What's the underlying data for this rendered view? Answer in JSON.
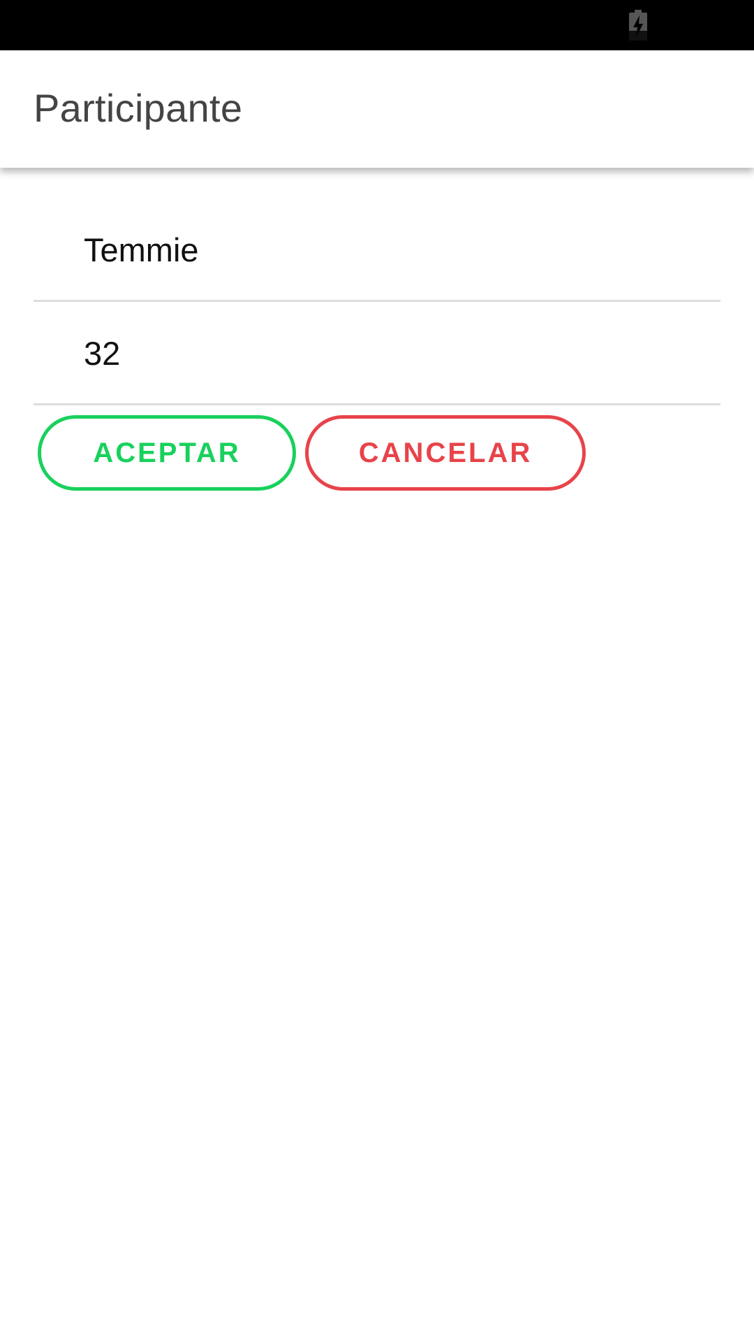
{
  "status_bar": {
    "icons": [
      "battery-charging-icon"
    ]
  },
  "app_bar": {
    "title": "Participante"
  },
  "form": {
    "name_value": "Temmie",
    "age_value": "32"
  },
  "actions": {
    "accept_label": "ACEPTAR",
    "cancel_label": "CANCELAR",
    "accept_color": "#18d15c",
    "cancel_color": "#e8434a"
  }
}
